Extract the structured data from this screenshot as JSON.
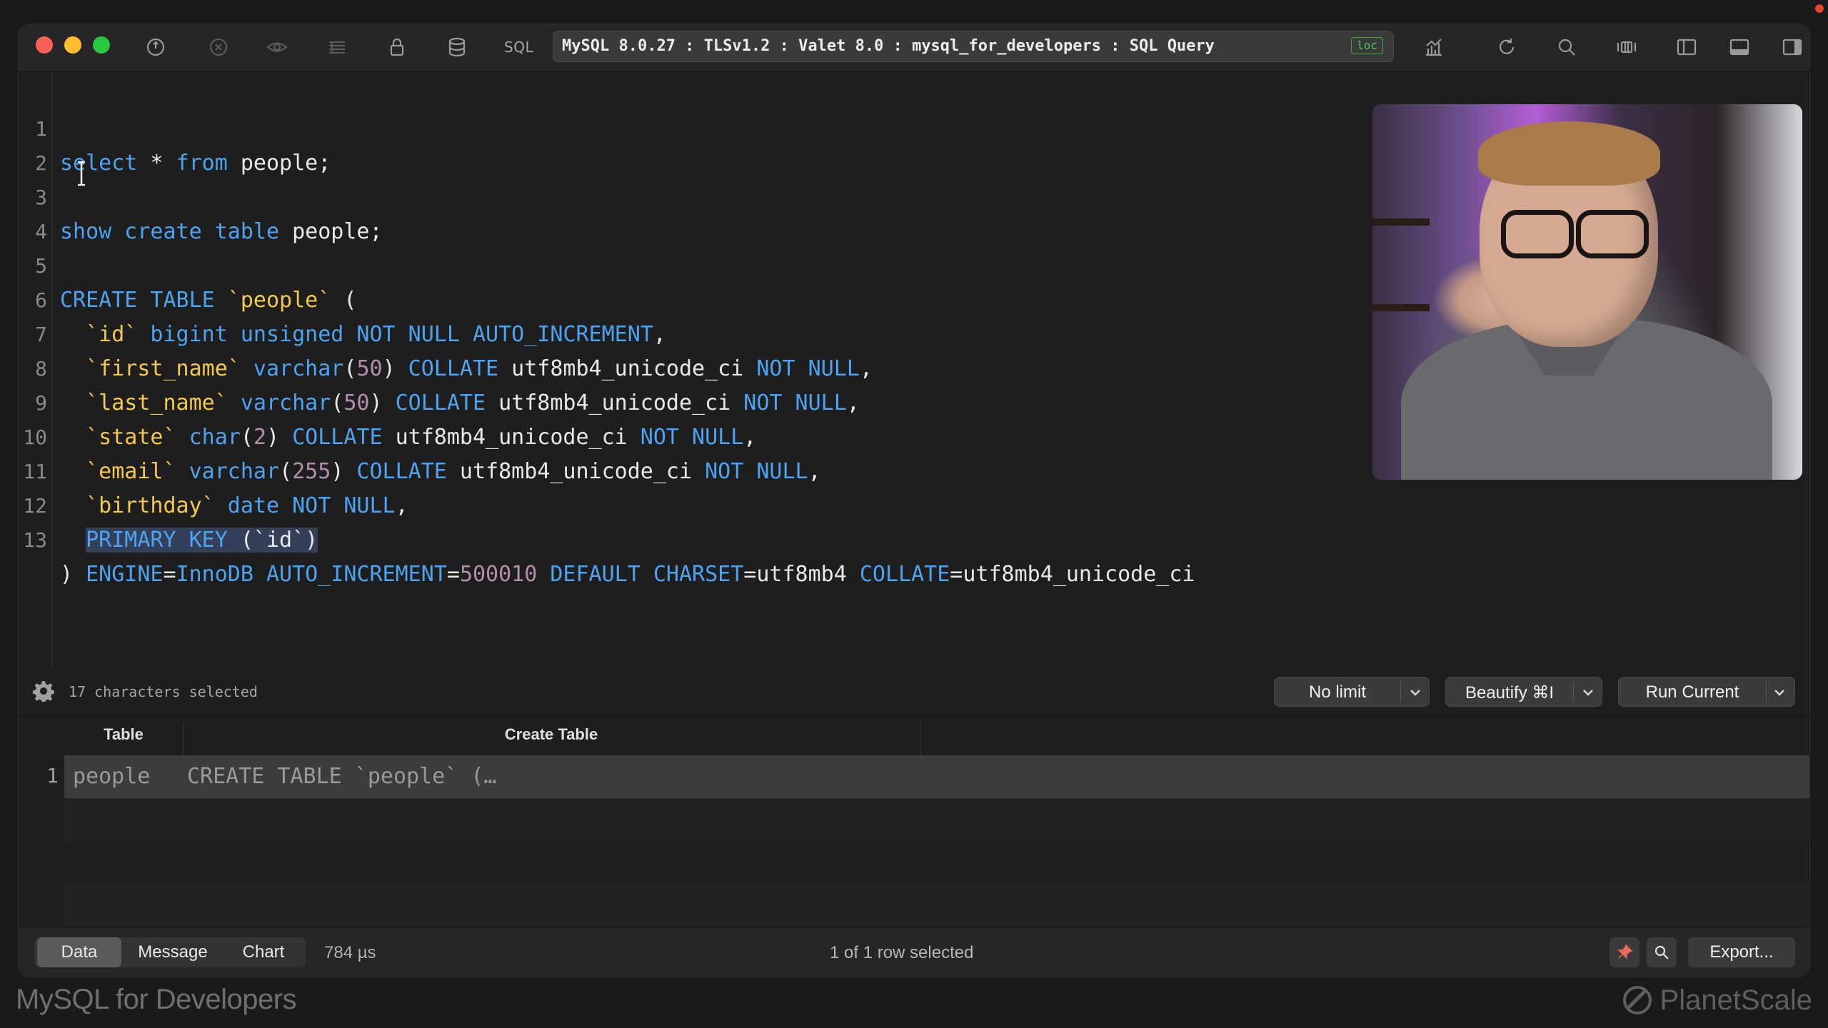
{
  "titlebar": {
    "sql_label": "SQL",
    "connection": "MySQL 8.0.27 : TLSv1.2 : Valet 8.0 : mysql_for_developers : SQL Query",
    "loc_badge": "loc",
    "accent_green": "#4fc14f"
  },
  "editor": {
    "lines": [
      "1",
      "2",
      "3",
      "4",
      "5",
      "6",
      "7",
      "8",
      "9",
      "10",
      "11",
      "12",
      "13"
    ],
    "tokens": {
      "l1_select": "select",
      "l1_star": " * ",
      "l1_from": "from",
      "l1_rest": " people;",
      "l3_show": "show create table",
      "l3_rest": " people;",
      "l5_create": "CREATE TABLE",
      "l5_tbl": " `people`",
      "l5_paren": " (",
      "l6_col": "  `id`",
      "l6_type": " bigint unsigned NOT NULL AUTO_INCREMENT",
      "l6_end": ",",
      "l7_col": "  `first_name`",
      "l7_type": " varchar",
      "l7_p1": "(",
      "l7_n": "50",
      "l7_p2": ")",
      "l7_collate": " COLLATE",
      "l7_coll": " utf8mb4_unicode_ci",
      "l7_nn": " NOT NULL",
      "l7_end": ",",
      "l8_col": "  `last_name`",
      "l8_type": " varchar",
      "l8_p1": "(",
      "l8_n": "50",
      "l8_p2": ")",
      "l8_collate": " COLLATE",
      "l8_coll": " utf8mb4_unicode_ci",
      "l8_nn": " NOT NULL",
      "l8_end": ",",
      "l9_col": "  `state`",
      "l9_type": " char",
      "l9_p1": "(",
      "l9_n": "2",
      "l9_p2": ")",
      "l9_collate": " COLLATE",
      "l9_coll": " utf8mb4_unicode_ci",
      "l9_nn": " NOT NULL",
      "l9_end": ",",
      "l10_col": "  `email`",
      "l10_type": " varchar",
      "l10_p1": "(",
      "l10_n": "255",
      "l10_p2": ")",
      "l10_collate": " COLLATE",
      "l10_coll": " utf8mb4_unicode_ci",
      "l10_nn": " NOT NULL",
      "l10_end": ",",
      "l11_col": "  `birthday`",
      "l11_type": " date NOT NULL",
      "l11_end": ",",
      "l12_pk": "PRIMARY KEY",
      "l12_rest": " (`id`)",
      "l13_p": ")",
      "l13_engine": " ENGINE",
      "l13_eq1": "=",
      "l13_innodb": "InnoDB",
      "l13_ai": " AUTO_INCREMENT",
      "l13_eq2": "=",
      "l13_num": "500010",
      "l13_default": " DEFAULT CHARSET",
      "l13_eq3": "=utf8mb4",
      "l13_collate": " COLLATE",
      "l13_eq4": "=utf8mb4_unicode_ci"
    }
  },
  "status": {
    "chars_selected": "17 characters selected",
    "limit": "No limit",
    "beautify": "Beautify ⌘I",
    "run": "Run Current"
  },
  "results": {
    "columns": [
      "Table",
      "Create Table"
    ],
    "rows": [
      {
        "num": "1",
        "table": "people",
        "create": "CREATE TABLE `people` (…"
      }
    ]
  },
  "bottombar": {
    "tabs": [
      "Data",
      "Message",
      "Chart"
    ],
    "timing": "784 µs",
    "rows_selected": "1 of 1 row selected",
    "export": "Export..."
  },
  "footer": {
    "course": "MySQL for Developers",
    "brand": "PlanetScale"
  }
}
